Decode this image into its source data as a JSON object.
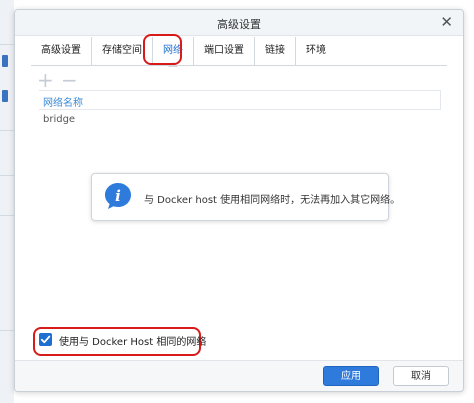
{
  "dialog": {
    "title": "高级设置",
    "close_icon": "close-icon"
  },
  "tabs": [
    {
      "label": "高级设置",
      "active": false
    },
    {
      "label": "存储空间",
      "active": false
    },
    {
      "label": "网络",
      "active": true
    },
    {
      "label": "端口设置",
      "active": false
    },
    {
      "label": "链接",
      "active": false
    },
    {
      "label": "环境",
      "active": false
    }
  ],
  "toolbar": {
    "add_icon": "plus-icon",
    "remove_icon": "minus-icon"
  },
  "network_table": {
    "header": "网络名称",
    "rows": [
      "bridge"
    ]
  },
  "info": {
    "icon": "info-icon",
    "message": "与 Docker host 使用相同网络时，无法再加入其它网络。"
  },
  "option": {
    "label": "使用与 Docker Host 相同的网络",
    "checked": true
  },
  "buttons": {
    "apply": "应用",
    "cancel": "取消"
  },
  "colors": {
    "accent": "#2f7bdc",
    "highlight": "#d71a1a"
  }
}
